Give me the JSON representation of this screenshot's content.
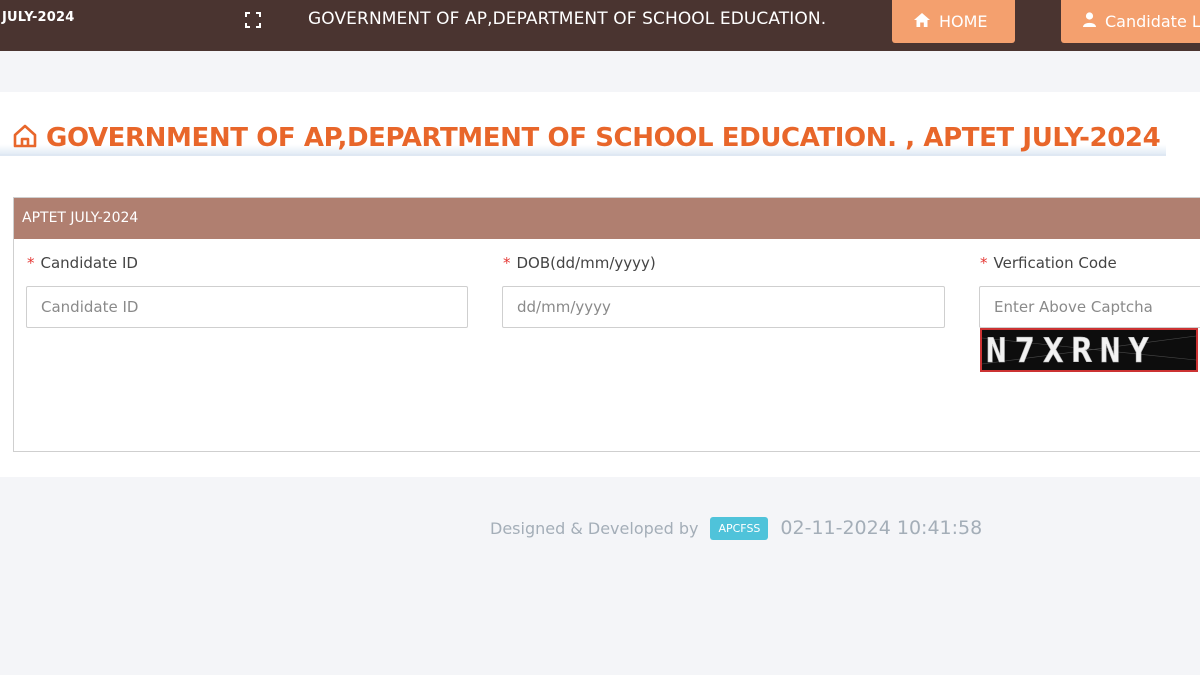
{
  "header": {
    "brand": "JULY-2024",
    "title": "GOVERNMENT OF AP,DEPARTMENT OF SCHOOL EDUCATION.",
    "nav": [
      {
        "label": "HOME",
        "icon": "home-icon"
      },
      {
        "label": "Candidate L",
        "icon": "user-icon"
      }
    ]
  },
  "page": {
    "heading": "GOVERNMENT OF AP,DEPARTMENT OF SCHOOL EDUCATION. , APTET JULY-2024",
    "heading_icon": "home-outline-icon"
  },
  "form": {
    "title": "APTET JULY-2024",
    "required_mark": "*",
    "fields": [
      {
        "label": "Candidate ID",
        "placeholder": "Candidate ID",
        "value": ""
      },
      {
        "label": "DOB(dd/mm/yyyy)",
        "placeholder": "dd/mm/yyyy",
        "value": ""
      },
      {
        "label": "Verfication Code",
        "placeholder": "Enter Above Captcha",
        "value": ""
      }
    ],
    "captcha_text": "N7XRNY"
  },
  "footer": {
    "credit": "Designed & Developed by",
    "badge": "APCFSS",
    "timestamp": "02-11-2024 10:41:58"
  },
  "colors": {
    "header_bg": "#4a3430",
    "nav_button": "#f4a06e",
    "heading": "#e8662a",
    "card_header": "#b07f70",
    "badge": "#4fc3da"
  }
}
